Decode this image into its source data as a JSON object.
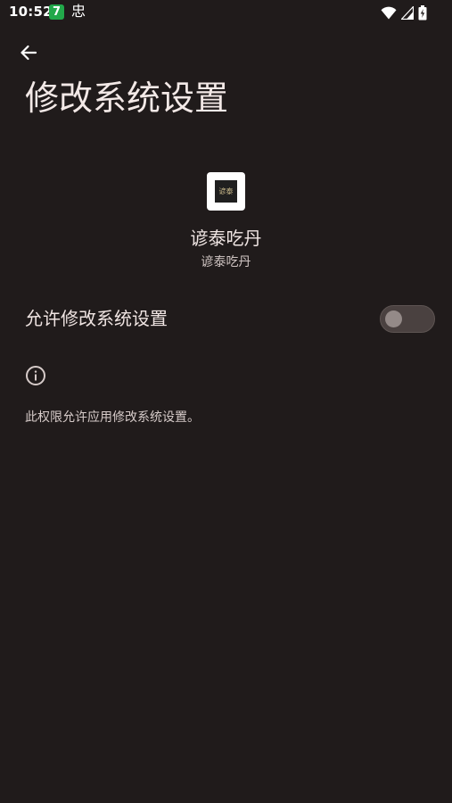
{
  "status_bar": {
    "time": "10:52",
    "notification_icon_1": "7",
    "notification_icon_2": "忠",
    "icons": [
      "wifi-icon",
      "signal-icon",
      "battery-icon"
    ]
  },
  "header": {
    "back_icon": "arrow-back-icon",
    "title": "修改系统设置"
  },
  "app": {
    "icon_text": "谚泰",
    "name": "谚泰吃丹",
    "package": "谚泰吃丹"
  },
  "setting": {
    "label": "允许修改系统设置",
    "enabled": false
  },
  "info": {
    "icon": "info-icon",
    "text": "此权限允许应用修改系统设置。"
  },
  "colors": {
    "background": "#201b1b",
    "toggle_track_off": "#4a4140",
    "toggle_thumb_off": "#948a88"
  }
}
